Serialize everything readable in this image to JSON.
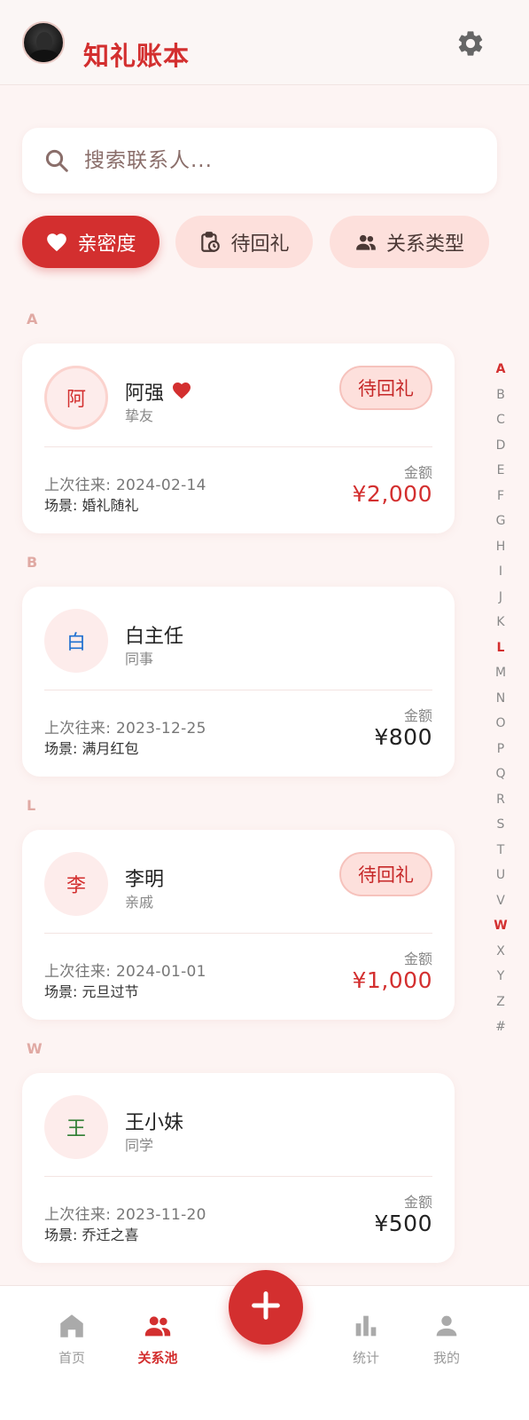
{
  "header": {
    "title": "知礼账本",
    "settings_icon": "gear-icon"
  },
  "search": {
    "placeholder": "搜索联系人..."
  },
  "filters": [
    {
      "label": "亲密度",
      "icon": "heart-icon",
      "active": true
    },
    {
      "label": "待回礼",
      "icon": "clipboard-clock-icon",
      "active": false
    },
    {
      "label": "关系类型",
      "icon": "people-icon",
      "active": false
    }
  ],
  "sections": [
    {
      "letter": "A",
      "contact": {
        "initial": "阿",
        "initial_color": "#d32f2f",
        "name": "阿强",
        "favorite": true,
        "relation": "挚友",
        "pending": "待回礼",
        "last_label": "上次往来: ",
        "last_date": "2024-02-14",
        "scene_label": "场景: ",
        "scene": "婚礼随礼",
        "amount_label": "金额",
        "amount": "¥2,000",
        "amount_color": "#d32f2f"
      }
    },
    {
      "letter": "B",
      "contact": {
        "initial": "白",
        "initial_color": "#1e6fd0",
        "name": "白主任",
        "favorite": false,
        "relation": "同事",
        "pending": "",
        "last_label": "上次往来: ",
        "last_date": "2023-12-25",
        "scene_label": "场景: ",
        "scene": "满月红包",
        "amount_label": "金额",
        "amount": "¥800",
        "amount_color": "#222222"
      }
    },
    {
      "letter": "L",
      "contact": {
        "initial": "李",
        "initial_color": "#d32f2f",
        "name": "李明",
        "favorite": false,
        "relation": "亲戚",
        "pending": "待回礼",
        "last_label": "上次往来: ",
        "last_date": "2024-01-01",
        "scene_label": "场景: ",
        "scene": "元旦过节",
        "amount_label": "金额",
        "amount": "¥1,000",
        "amount_color": "#d32f2f"
      }
    },
    {
      "letter": "W",
      "contact": {
        "initial": "王",
        "initial_color": "#2e7d32",
        "name": "王小妹",
        "favorite": false,
        "relation": "同学",
        "pending": "",
        "last_label": "上次往来: ",
        "last_date": "2023-11-20",
        "scene_label": "场景: ",
        "scene": "乔迁之喜",
        "amount_label": "金额",
        "amount": "¥500",
        "amount_color": "#222222"
      }
    }
  ],
  "alphabet": [
    "A",
    "B",
    "C",
    "D",
    "E",
    "F",
    "G",
    "H",
    "I",
    "J",
    "K",
    "L",
    "M",
    "N",
    "O",
    "P",
    "Q",
    "R",
    "S",
    "T",
    "U",
    "V",
    "W",
    "X",
    "Y",
    "Z",
    "#"
  ],
  "alphabet_active": [
    "A",
    "L",
    "W"
  ],
  "bottom_nav": [
    {
      "label": "首页",
      "icon": "home-icon",
      "active": false
    },
    {
      "label": "关系池",
      "icon": "people-icon",
      "active": true
    },
    {
      "label": "统计",
      "icon": "bar-chart-icon",
      "active": false
    },
    {
      "label": "我的",
      "icon": "person-icon",
      "active": false
    }
  ],
  "fab_icon": "plus-icon",
  "colors": {
    "accent": "#d32f2f",
    "chip_bg": "#fde0dc",
    "page_bg": "#fdf4f3"
  }
}
